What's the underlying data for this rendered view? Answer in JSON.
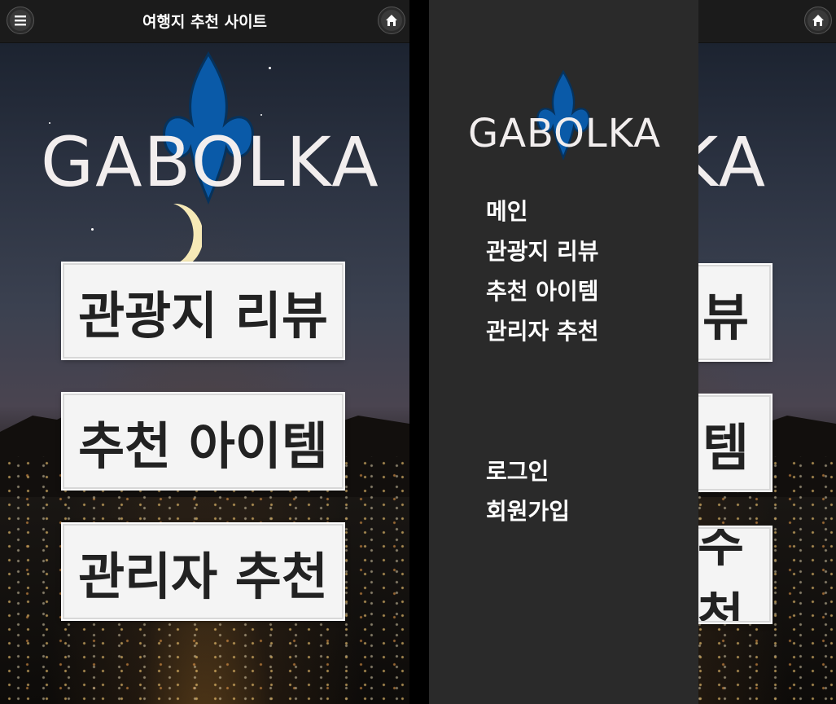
{
  "header": {
    "title": "여행지 추천 사이트",
    "menu_icon": "hamburger-menu-icon",
    "home_icon": "home-icon"
  },
  "logo": {
    "text": "GABOLKA",
    "emblem": "fleur-de-lis-icon",
    "emblem_color": "#0a5aa8"
  },
  "main_buttons": [
    {
      "label": "관광지 리뷰"
    },
    {
      "label": "추천 아이템"
    },
    {
      "label": "관리자 추천"
    }
  ],
  "right_buttons": [
    {
      "label": "뷰"
    },
    {
      "label": "템"
    },
    {
      "label": "추천"
    }
  ],
  "drawer": {
    "nav": [
      {
        "label": "메인"
      },
      {
        "label": "관광지 리뷰"
      },
      {
        "label": "추천 아이템"
      },
      {
        "label": "관리자 추천"
      }
    ],
    "account": [
      {
        "label": "로그인"
      },
      {
        "label": "회원가입"
      }
    ]
  },
  "colors": {
    "topbar": "#1b1b1b",
    "drawer": "#2a2a2a",
    "button_bg": "#f4f4f4",
    "accent": "#0a5aa8"
  }
}
